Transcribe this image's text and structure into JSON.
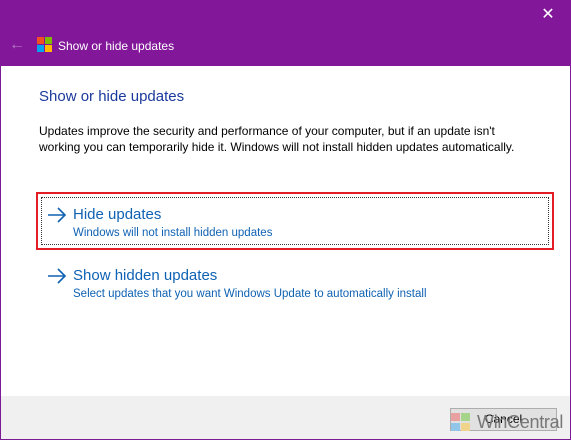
{
  "window": {
    "title": "Show or hide updates",
    "close_glyph": "✕",
    "back_glyph": "←",
    "accent_color": "#82179a"
  },
  "content": {
    "heading": "Show or hide updates",
    "description": "Updates improve the security and performance of your computer, but if an update isn't working you can temporarily hide it. Windows will not install hidden updates automatically.",
    "options": [
      {
        "icon": "arrow-right-icon",
        "title": "Hide updates",
        "subtitle": "Windows will not install hidden updates",
        "highlighted": true
      },
      {
        "icon": "arrow-right-icon",
        "title": "Show hidden updates",
        "subtitle": "Select updates that you want Windows Update to automatically install",
        "highlighted": false
      }
    ],
    "link_color": "#0f62b3",
    "highlight_color": "#e21d25"
  },
  "footer": {
    "cancel_label": "Cancel"
  },
  "watermark": {
    "text": "WinCentral"
  }
}
